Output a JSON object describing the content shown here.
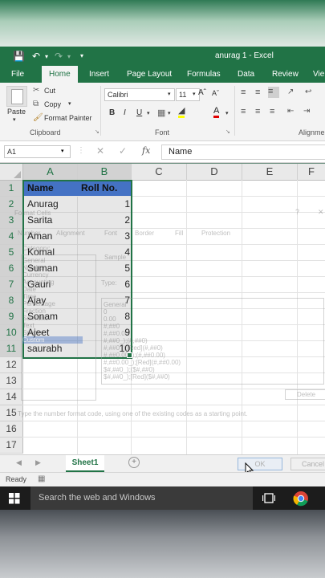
{
  "window": {
    "title": "anurag 1 - Excel"
  },
  "ribbon_tabs": [
    "File",
    "Home",
    "Insert",
    "Page Layout",
    "Formulas",
    "Data",
    "Review",
    "Vie"
  ],
  "clipboard": {
    "paste": "Paste",
    "cut": "Cut",
    "copy": "Copy",
    "format_painter": "Format Painter",
    "group_label": "Clipboard"
  },
  "font": {
    "family": "Calibri",
    "size": "11",
    "bold": "B",
    "italic": "I",
    "underline": "U",
    "group_label": "Font"
  },
  "alignment": {
    "group_label": "Alignme"
  },
  "formula_bar": {
    "name_box": "A1",
    "fx": "fx",
    "value": "Name"
  },
  "columns": [
    "A",
    "B",
    "C",
    "D",
    "E",
    "F"
  ],
  "rows": [
    "1",
    "2",
    "3",
    "4",
    "5",
    "6",
    "7",
    "8",
    "9",
    "10",
    "11",
    "12",
    "13",
    "14",
    "15",
    "16",
    "17"
  ],
  "table": {
    "headers": [
      "Name",
      "Roll No."
    ],
    "rows": [
      [
        "Anurag",
        "1"
      ],
      [
        "Sarita",
        "2"
      ],
      [
        "Aman",
        "3"
      ],
      [
        "Komal",
        "4"
      ],
      [
        "Suman",
        "5"
      ],
      [
        "Gauri",
        "6"
      ],
      [
        "Ajay",
        "7"
      ],
      [
        "Sonam",
        "8"
      ],
      [
        "Ajeet",
        "9"
      ],
      [
        "saurabh",
        "10"
      ]
    ]
  },
  "dialog_ghost": {
    "title": "Format Cells",
    "help": "?",
    "tabs": [
      "Number",
      "Alignment",
      "Font",
      "Border",
      "Fill",
      "Protection"
    ],
    "category_label": "Category:",
    "categories": [
      "General",
      "Number",
      "Currency",
      "Accounting",
      "Date",
      "Time",
      "Percentage",
      "Fraction",
      "Scientific",
      "Text",
      "Special",
      "Custom"
    ],
    "sample_label": "Sample",
    "type_label": "Type:",
    "type_value": "General",
    "formats": [
      "General",
      "0",
      "0.00",
      "#,##0",
      "#,##0.00",
      "#,##0_);(#,##0)",
      "#,##0_);[Red](#,##0)",
      "#,##0.00_);(#,##0.00)",
      "#,##0.00_);[Red](#,##0.00)",
      "$#,##0_);($#,##0)",
      "$#,##0_);[Red]($#,##0)"
    ],
    "delete": "Delete",
    "hint": "Type the number format code, using one of the existing codes as a starting point.",
    "ok": "OK",
    "cancel": "Cancel"
  },
  "sheet_tabs": [
    "Sheet1"
  ],
  "status": {
    "ready": "Ready"
  },
  "taskbar": {
    "search_placeholder": "Search the web and Windows"
  }
}
